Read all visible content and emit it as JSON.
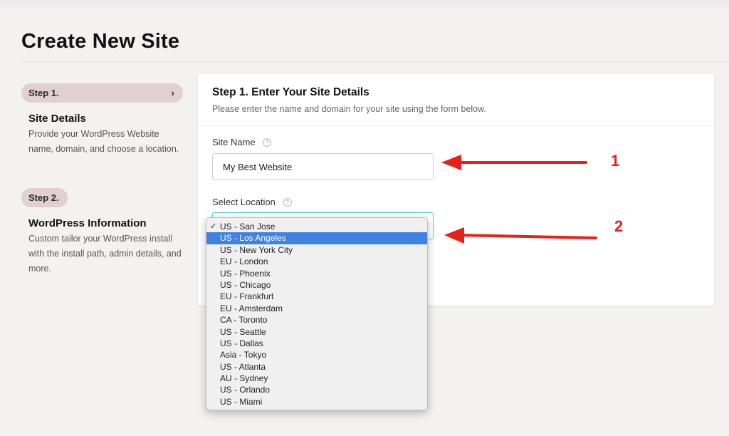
{
  "page": {
    "title": "Create New Site"
  },
  "sidebar": {
    "step1": {
      "pill_label": "Step 1.",
      "heading": "Site Details",
      "description": "Provide your WordPress Website name, domain, and choose a location."
    },
    "step2": {
      "pill_label": "Step 2.",
      "heading": "WordPress Information",
      "description": "Custom tailor your WordPress install with the install path, admin details, and more."
    }
  },
  "card": {
    "title": "Step 1. Enter Your Site Details",
    "subtitle": "Please enter the name and domain for your site using the form below.",
    "site_name": {
      "label": "Site Name",
      "value": "My Best Website"
    },
    "location": {
      "label": "Select Location",
      "checked": "US - San Jose",
      "highlighted": "US - Los Angeles",
      "options": [
        "US - San Jose",
        "US - Los Angeles",
        "US - New York City",
        "EU - London",
        "US - Phoenix",
        "US - Chicago",
        "EU - Frankfurt",
        "EU - Amsterdam",
        "CA - Toronto",
        "US - Seattle",
        "US - Dallas",
        "Asia - Tokyo",
        "US - Atlanta",
        "AU - Sydney",
        "US - Orlando",
        "US - Miami"
      ]
    }
  },
  "annotations": {
    "one": "1",
    "two": "2"
  },
  "colors": {
    "accent_pill": "#e2cfd1",
    "highlight": "#3f82e0",
    "annotation": "#e8201a",
    "focus_border": "#59c9d8"
  },
  "icons": {
    "chevron": "chevron-right-icon",
    "help": "question-circle-icon",
    "check": "checkmark-icon"
  }
}
